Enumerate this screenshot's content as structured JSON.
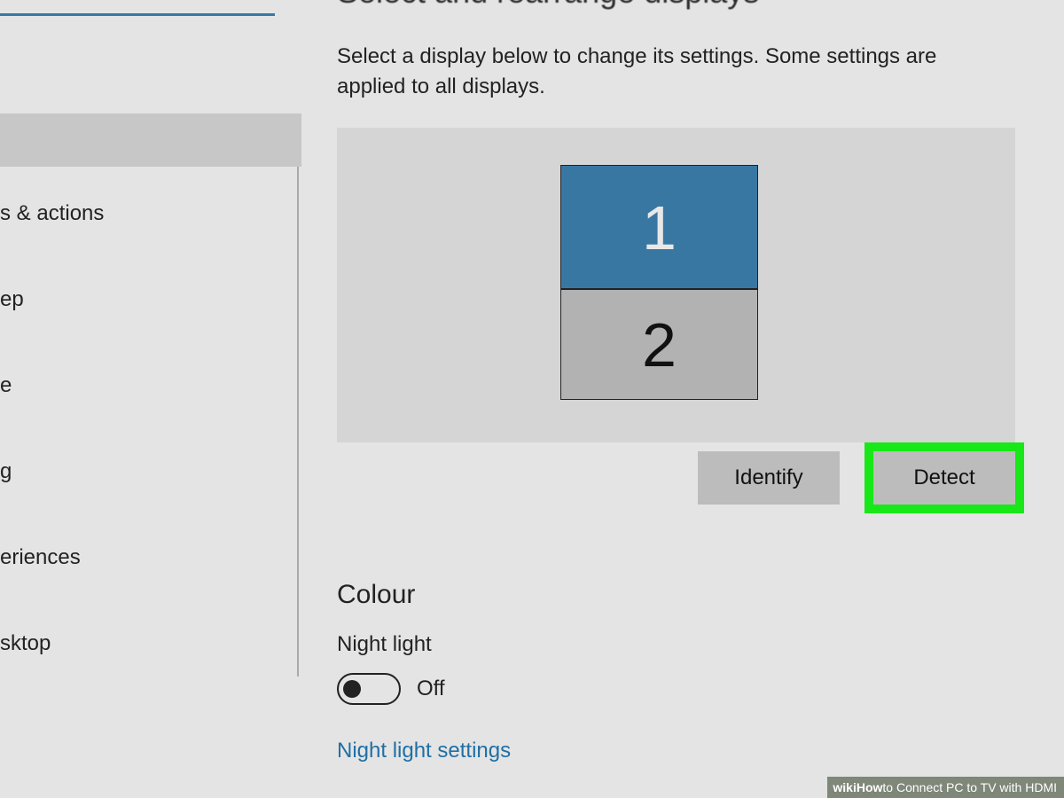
{
  "heading_partial": "Select and rearrange displays",
  "description": "Select a display below to change its settings. Some settings are applied to all displays.",
  "displays": {
    "primary": "1",
    "secondary": "2"
  },
  "buttons": {
    "identify": "Identify",
    "detect": "Detect"
  },
  "colour": {
    "heading": "Colour",
    "night_light_label": "Night light",
    "night_light_state": "Off",
    "night_light_link": "Night light settings"
  },
  "sidebar": {
    "items": [
      "s & actions",
      "ep",
      "",
      "e",
      "g",
      "eriences",
      "sktop"
    ]
  },
  "footer": {
    "prefix_wiki": "wiki",
    "prefix_how": "How",
    "title": " to Connect PC to TV with HDMI"
  }
}
